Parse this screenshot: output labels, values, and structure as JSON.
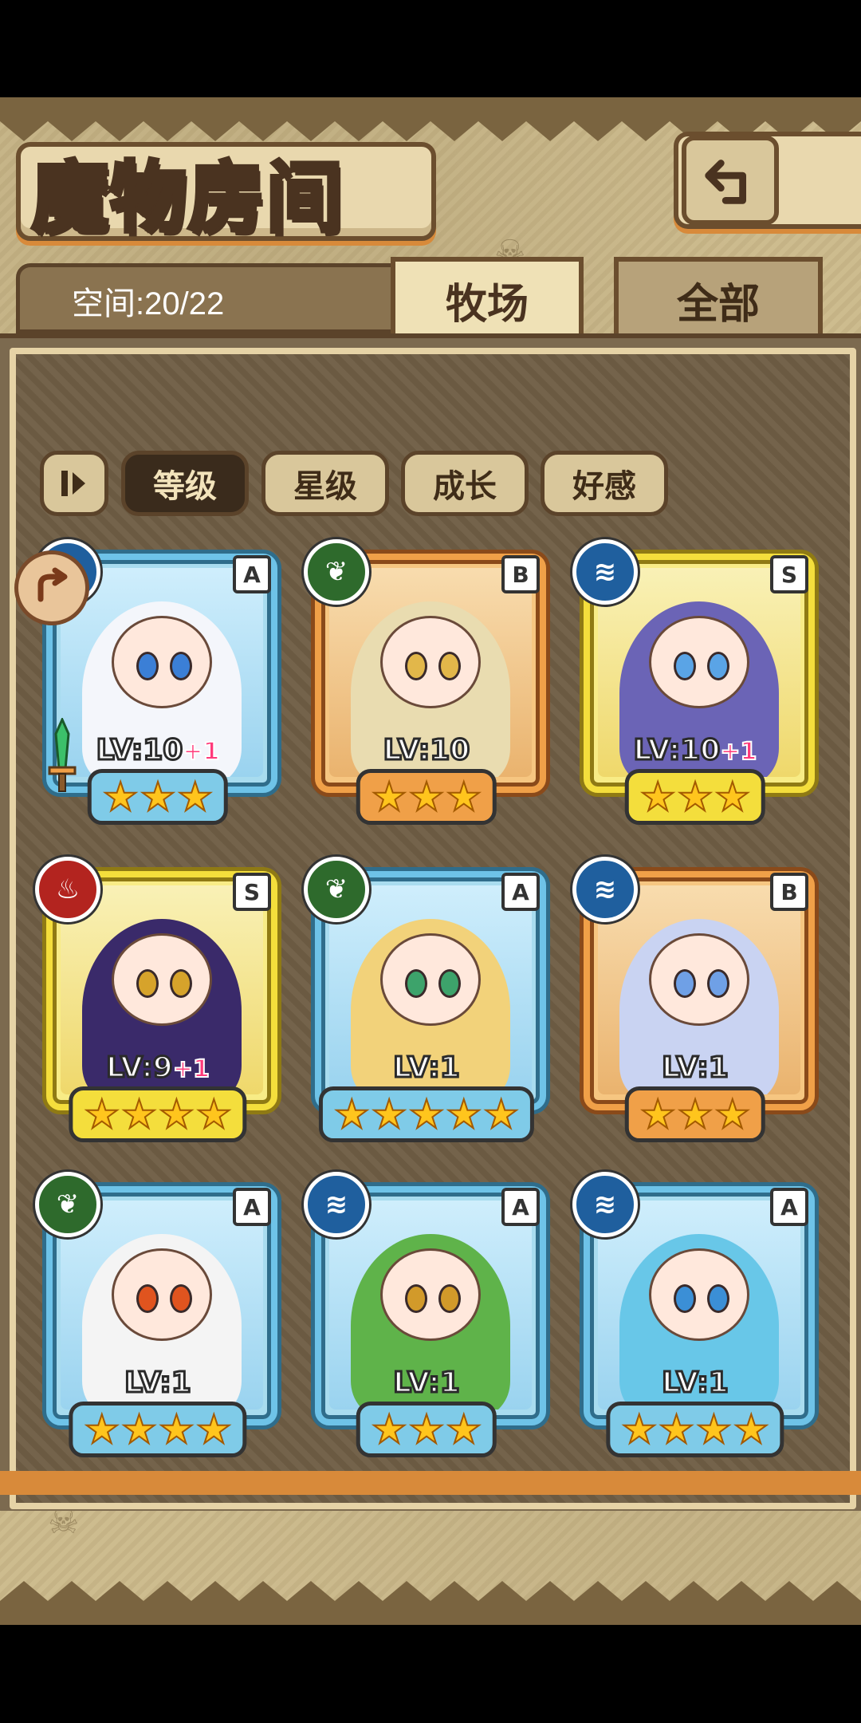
{
  "header": {
    "title": "魔物房间",
    "back_icon": "return-arrow-icon"
  },
  "storage": {
    "space_text": "空间:20/22"
  },
  "tabs": [
    {
      "label": "牧场",
      "active": true
    },
    {
      "label": "全部",
      "active": false
    }
  ],
  "sort": {
    "toggle_icon": "sort-order-icon",
    "options": [
      {
        "label": "等级",
        "active": true
      },
      {
        "label": "星级",
        "active": false
      },
      {
        "label": "成长",
        "active": false
      },
      {
        "label": "好感",
        "active": false
      }
    ]
  },
  "monsters": [
    {
      "rank": "A",
      "element": "water",
      "level": "LV:10",
      "bonus": "+1",
      "stars": 3,
      "frame": "blue"
    },
    {
      "rank": "B",
      "element": "grass",
      "level": "LV:10",
      "bonus": "",
      "stars": 3,
      "frame": "orange"
    },
    {
      "rank": "S",
      "element": "water",
      "level": "LV:10",
      "bonus": "+1",
      "stars": 3,
      "frame": "gold"
    },
    {
      "rank": "S",
      "element": "fire",
      "level": "LV:9",
      "bonus": "+1",
      "stars": 4,
      "frame": "gold"
    },
    {
      "rank": "A",
      "element": "grass",
      "level": "LV:1",
      "bonus": "",
      "stars": 5,
      "frame": "blue"
    },
    {
      "rank": "B",
      "element": "water",
      "level": "LV:1",
      "bonus": "",
      "stars": 3,
      "frame": "orange"
    },
    {
      "rank": "A",
      "element": "grass",
      "level": "LV:1",
      "bonus": "",
      "stars": 4,
      "frame": "blue"
    },
    {
      "rank": "A",
      "element": "water",
      "level": "LV:1",
      "bonus": "",
      "stars": 3,
      "frame": "blue"
    },
    {
      "rank": "A",
      "element": "water",
      "level": "LV:1",
      "bonus": "",
      "stars": 4,
      "frame": "blue"
    }
  ],
  "colors": {
    "background_parchment": "#cbb98a",
    "panel": "#6f5e45",
    "frame_blue": "#6ec3e8",
    "frame_orange": "#f0a048",
    "frame_gold": "#f4de3c",
    "element_grass": "#2e6a2c",
    "element_water": "#1f5f9e",
    "element_fire": "#b3241f",
    "bonus_pink": "#ff3a7a"
  }
}
